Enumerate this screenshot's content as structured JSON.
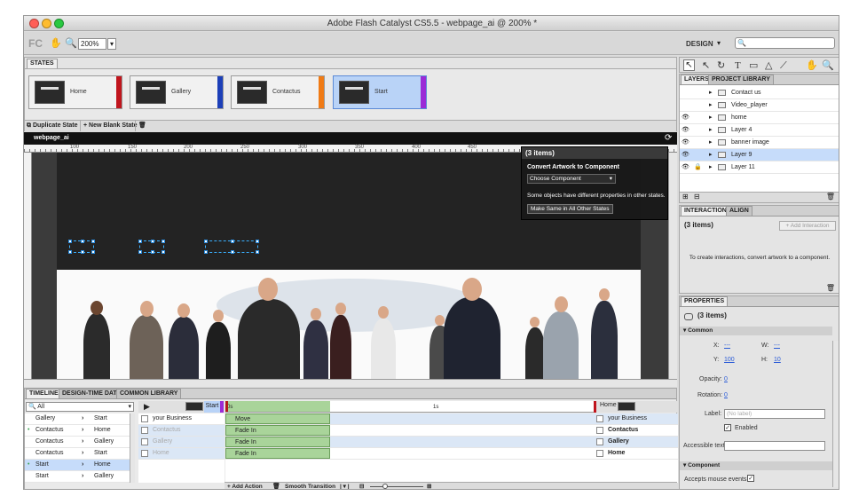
{
  "window": {
    "title": "Adobe Flash Catalyst CS5.5 - webpage_ai @ 200% *"
  },
  "toolbar": {
    "logo": "FC",
    "zoom": "200%",
    "workspace": "DESIGN",
    "search_placeholder": ""
  },
  "states": {
    "tab": "STATES",
    "items": [
      {
        "label": "Home",
        "color": "#c0151d"
      },
      {
        "label": "Gallery",
        "color": "#1c3fb8"
      },
      {
        "label": "Contactus",
        "color": "#f07a14"
      },
      {
        "label": "Start",
        "color": "#9b2bd6"
      }
    ],
    "duplicate": "Duplicate State",
    "new_blank": "New Blank State"
  },
  "canvas": {
    "doc_name": "webpage_ai",
    "ruler_ticks": [
      "100",
      "150",
      "200",
      "250",
      "300",
      "350",
      "400",
      "450"
    ]
  },
  "hud": {
    "count": "(3 items)",
    "heading": "Convert Artwork to Component",
    "select": "Choose Component",
    "note": "Some objects have different properties in other states.",
    "button": "Make Same in All Other States"
  },
  "tools": [
    "selection",
    "direct-select",
    "rotate",
    "text",
    "rectangle",
    "triangle",
    "line",
    "hand",
    "zoom"
  ],
  "layers": {
    "tabs": [
      "LAYERS",
      "PROJECT LIBRARY"
    ],
    "items": [
      {
        "name": "Contact us",
        "visible": false,
        "selected": false
      },
      {
        "name": "Video_player",
        "visible": false,
        "selected": false
      },
      {
        "name": "home",
        "visible": true,
        "selected": false
      },
      {
        "name": "Layer 4",
        "visible": true,
        "selected": false
      },
      {
        "name": "banner image",
        "visible": true,
        "selected": false
      },
      {
        "name": "Layer 9",
        "visible": true,
        "selected": true
      },
      {
        "name": "Layer 11",
        "visible": true,
        "selected": false
      }
    ]
  },
  "interactions": {
    "tabs": [
      "INTERACTIONS",
      "ALIGN"
    ],
    "count": "(3 items)",
    "add": "+ Add Interaction",
    "message": "To create interactions, convert artwork to a component."
  },
  "properties": {
    "tab": "PROPERTIES",
    "count": "(3 items)",
    "common": "Common",
    "x_label": "X:",
    "x_value": "---",
    "w_label": "W:",
    "w_value": "---",
    "y_label": "Y:",
    "y_value": "100",
    "h_label": "H:",
    "h_value": "10",
    "opacity_label": "Opacity:",
    "opacity_value": "0",
    "rotation_label": "Rotation:",
    "rotation_value": "0",
    "label_label": "Label:",
    "label_placeholder": "(No label)",
    "enabled": "Enabled",
    "accessible_label": "Accessible text:",
    "component": "Component",
    "mouse_events": "Accepts mouse events:"
  },
  "timelines": {
    "tabs": [
      "TIMELINES",
      "DESIGN-TIME DATA",
      "COMMON LIBRARY"
    ],
    "filter": "All",
    "transitions": [
      {
        "from": "Gallery",
        "to": "Start",
        "dot": false
      },
      {
        "from": "Contactus",
        "to": "Home",
        "dot": true
      },
      {
        "from": "Contactus",
        "to": "Gallery",
        "dot": false
      },
      {
        "from": "Contactus",
        "to": "Start",
        "dot": false
      },
      {
        "from": "Start",
        "to": "Home",
        "dot": true
      },
      {
        "from": "Start",
        "to": "Gallery",
        "dot": false
      }
    ],
    "state_from": "Start",
    "state_to": "Home",
    "time_start": "0s",
    "time_mid": "1s",
    "left_rows": [
      "your Business",
      "Contactus",
      "Gallery",
      "Home"
    ],
    "effects": [
      "Move",
      "Fade In",
      "Fade In",
      "Fade In"
    ],
    "right_rows": [
      "your Business",
      "Contactus",
      "Gallery",
      "Home"
    ],
    "add_action": "+ Add Action",
    "smooth": "Smooth Transition"
  }
}
